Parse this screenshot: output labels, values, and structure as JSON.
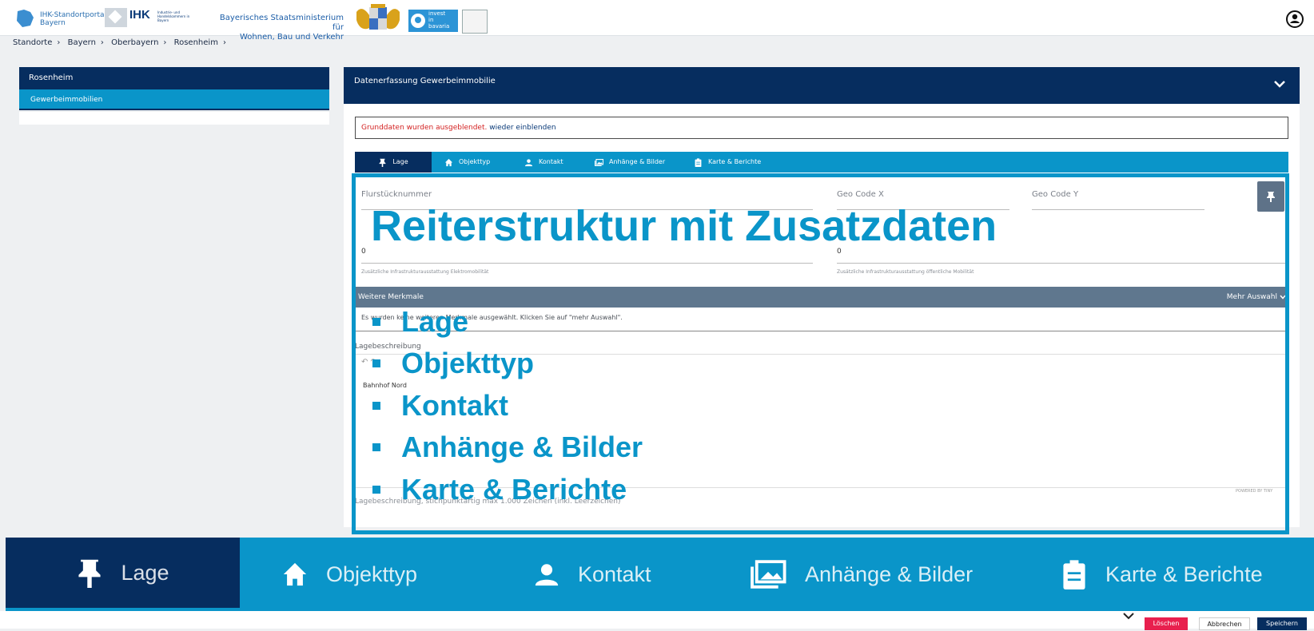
{
  "header": {
    "portal_line1": "IHK-Standortportal",
    "portal_line2": "Bayern",
    "ihk_label": "IHK",
    "ihk_sub": "Industrie- und Handelskammern in Bayern",
    "ministry_line1": "Bayerisches Staatsministerium für",
    "ministry_line2": "Wohnen, Bau und Verkehr",
    "invest_line1": "invest",
    "invest_line2": "in",
    "invest_line3": "bavaria"
  },
  "breadcrumb": [
    "Standorte",
    "Bayern",
    "Oberbayern",
    "Rosenheim"
  ],
  "sidebar": {
    "title": "Rosenheim",
    "items": [
      {
        "label": "Gewerbeimmobilien"
      }
    ]
  },
  "main": {
    "title": "Datenerfassung Gewerbeimmobilie",
    "notice_hidden": "Grunddaten wurden ausgeblendet.",
    "notice_link": "wieder einblenden",
    "tabs": [
      {
        "label": "Lage",
        "icon": "pin-icon"
      },
      {
        "label": "Objekttyp",
        "icon": "home-icon"
      },
      {
        "label": "Kontakt",
        "icon": "person-icon"
      },
      {
        "label": "Anhänge & Bilder",
        "icon": "images-icon"
      },
      {
        "label": "Karte & Berichte",
        "icon": "clipboard-icon"
      }
    ],
    "fields": {
      "flurstueck": "Flurstücknummer",
      "geo_x": "Geo Code X",
      "geo_y": "Geo Code Y",
      "value_left": "0",
      "value_right": "0",
      "hint_left": "Zusätzliche Infrastrukturausstattung Elektromobilität",
      "hint_right": "Zusätzliche Infrastrukturausstattung öffentliche Mobilität"
    },
    "merkmale": {
      "title": "Weitere Merkmale",
      "more": "Mehr Auswahl",
      "text": "Es wurden keine weiteren Merkmale ausgewählt. Klicken Sie auf \"mehr Auswahl\"."
    },
    "lage": {
      "label": "Lagebeschreibung",
      "content": "Bahnhof Nord",
      "powered": "POWERED BY TINY",
      "hint": "Lagebeschreibung, stichpunktartig max 1.000 Zeichen (inkl. Leerzeichen)"
    }
  },
  "overlay": {
    "title": "Reiterstruktur mit Zusatzdaten",
    "items": [
      "Lage",
      "Objekttyp",
      "Kontakt",
      "Anhänge & Bilder",
      "Karte & Berichte"
    ]
  },
  "bigtabs": [
    {
      "label": "Lage",
      "icon": "pin-icon"
    },
    {
      "label": "Objekttyp",
      "icon": "home-icon"
    },
    {
      "label": "Kontakt",
      "icon": "person-icon"
    },
    {
      "label": "Anhänge & Bilder",
      "icon": "images-icon"
    },
    {
      "label": "Karte & Berichte",
      "icon": "clipboard-icon"
    }
  ],
  "footer": {
    "delete": "Löschen",
    "cancel": "Abbrechen",
    "save": "Speichern"
  },
  "colors": {
    "navy": "#062d5f",
    "accent": "#0a95c9",
    "danger": "#e8204e"
  }
}
